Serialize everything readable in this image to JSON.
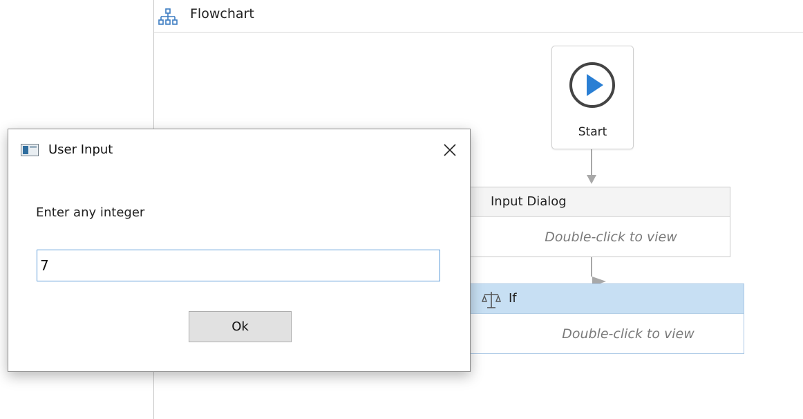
{
  "designer": {
    "title": "Flowchart",
    "start_label": "Start",
    "activities": [
      {
        "title": "Input Dialog",
        "hint": "Double-click to view"
      },
      {
        "title": "If",
        "hint": "Double-click to view"
      }
    ]
  },
  "dialog": {
    "title": "User Input",
    "prompt": "Enter any integer",
    "input_value": "7",
    "ok_label": "Ok"
  },
  "icons": {
    "flowchart": "flowchart-icon",
    "start": "play-circle-icon",
    "if": "if-decision-icon",
    "dialog": "window-icon",
    "close": "close-icon"
  },
  "colors": {
    "accent": "#2a7fd4",
    "if_header": "#c7dff3",
    "start_ring": "#444444"
  }
}
